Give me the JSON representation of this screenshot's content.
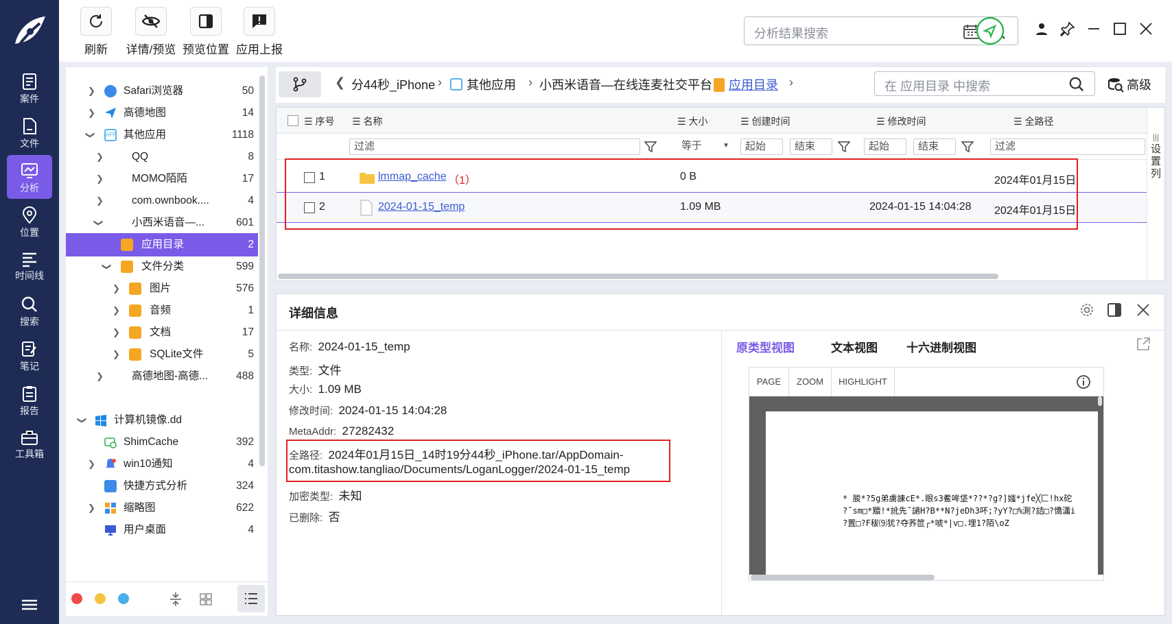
{
  "toolbar": {
    "refresh": "刷新",
    "details_preview": "详情/预览",
    "preview_position": "预览位置",
    "app_report": "应用上报",
    "search_placeholder": "分析结果搜索"
  },
  "nav": {
    "items": [
      {
        "label": "案件",
        "icon": "case-icon"
      },
      {
        "label": "文件",
        "icon": "file-icon"
      },
      {
        "label": "分析",
        "icon": "analysis-icon"
      },
      {
        "label": "位置",
        "icon": "location-icon"
      },
      {
        "label": "时间线",
        "icon": "timeline-icon"
      },
      {
        "label": "搜索",
        "icon": "search-icon"
      },
      {
        "label": "笔记",
        "icon": "note-icon"
      },
      {
        "label": "报告",
        "icon": "report-icon"
      },
      {
        "label": "工具箱",
        "icon": "toolbox-icon"
      }
    ],
    "active": "分析"
  },
  "tree": [
    {
      "label": "Safari浏览器",
      "count": "50"
    },
    {
      "label": "高德地图",
      "count": "14"
    },
    {
      "label": "其他应用",
      "count": "1118"
    },
    {
      "label": "QQ",
      "count": "8"
    },
    {
      "label": "MOMO陌陌",
      "count": "17"
    },
    {
      "label": "com.ownbook....",
      "count": "4"
    },
    {
      "label": "小西米语音—...",
      "count": "601"
    },
    {
      "label": "应用目录",
      "count": "2"
    },
    {
      "label": "文件分类",
      "count": "599"
    },
    {
      "label": "图片",
      "count": "576"
    },
    {
      "label": "音频",
      "count": "1"
    },
    {
      "label": "文档",
      "count": "17"
    },
    {
      "label": "SQLite文件",
      "count": "5"
    },
    {
      "label": "高德地图-高德...",
      "count": "488"
    },
    {
      "label": "计算机镜像.dd",
      "count": ""
    },
    {
      "label": "ShimCache",
      "count": "392"
    },
    {
      "label": "win10通知",
      "count": "4"
    },
    {
      "label": "快捷方式分析",
      "count": "324"
    },
    {
      "label": "缩略图",
      "count": "622"
    },
    {
      "label": "用户桌面",
      "count": "4"
    }
  ],
  "breadcrumb": {
    "items": [
      "分44秒_iPhone",
      "其他应用",
      "小西米语音—在线连麦社交平台",
      "应用目录"
    ],
    "search_placeholder": "在 应用目录 中搜索",
    "advanced": "高级"
  },
  "grid": {
    "columns": [
      "序号",
      "名称",
      "大小",
      "创建时间",
      "修改时间",
      "全路径"
    ],
    "filter_placeholder": "过滤",
    "size_op": "等于",
    "start": "起始",
    "end": "结束",
    "settings_col": [
      "设",
      "置",
      "列"
    ],
    "rows": [
      {
        "index": "1",
        "name": "lmmap_cache",
        "count": "（1）",
        "size": "0 B",
        "created": "",
        "modified": "2024年01月15日"
      },
      {
        "index": "2",
        "name": "2024-01-15_temp",
        "count": "",
        "size": "1.09 MB",
        "created": "2024-01-15 14:04:28",
        "modified": "2024年01月15日"
      }
    ]
  },
  "detail": {
    "title": "详细信息",
    "fields": [
      {
        "label": "名称:",
        "value": "2024-01-15_temp"
      },
      {
        "label": "类型:",
        "value": "文件"
      },
      {
        "label": "大小:",
        "value": "1.09 MB"
      },
      {
        "label": "修改时间:",
        "value": "2024-01-15 14:04:28"
      },
      {
        "label": "MetaAddr:",
        "value": "27282432"
      },
      {
        "label": "全路径:",
        "value": "2024年01月15日_14时19分44秒_iPhone.tar/AppDomain-",
        "value2": "com.titashow.tangliao/Documents/LoganLogger/2024-01-15_temp"
      },
      {
        "label": "加密类型:",
        "value": "未知"
      },
      {
        "label": "已删除:",
        "value": "否"
      }
    ],
    "tabs": [
      "原类型视图",
      "文本视图",
      "十六进制视图"
    ],
    "viewer_buttons": [
      "PAGE",
      "ZOOM",
      "HIGHLIGHT"
    ],
    "content_lines": [
      "*  脧*?5g弟虜諌cE*.眼s3鲝哞垡*??*?g?]媸*jfe╳匚!hx砣",
      "?˜sm□*黷!*訛先˜讁H?B**N?jeDh3吥;?yY?□%測?詰□?憍瀟i",
      "?置□?F秡⑼犹?夺荞笸┌*唬*|v□.埋1?陌\\oZ"
    ]
  },
  "colors": {
    "accent": "#7a5be8",
    "nav_bg": "#1d2b55",
    "highlight_border": "#e02020"
  }
}
